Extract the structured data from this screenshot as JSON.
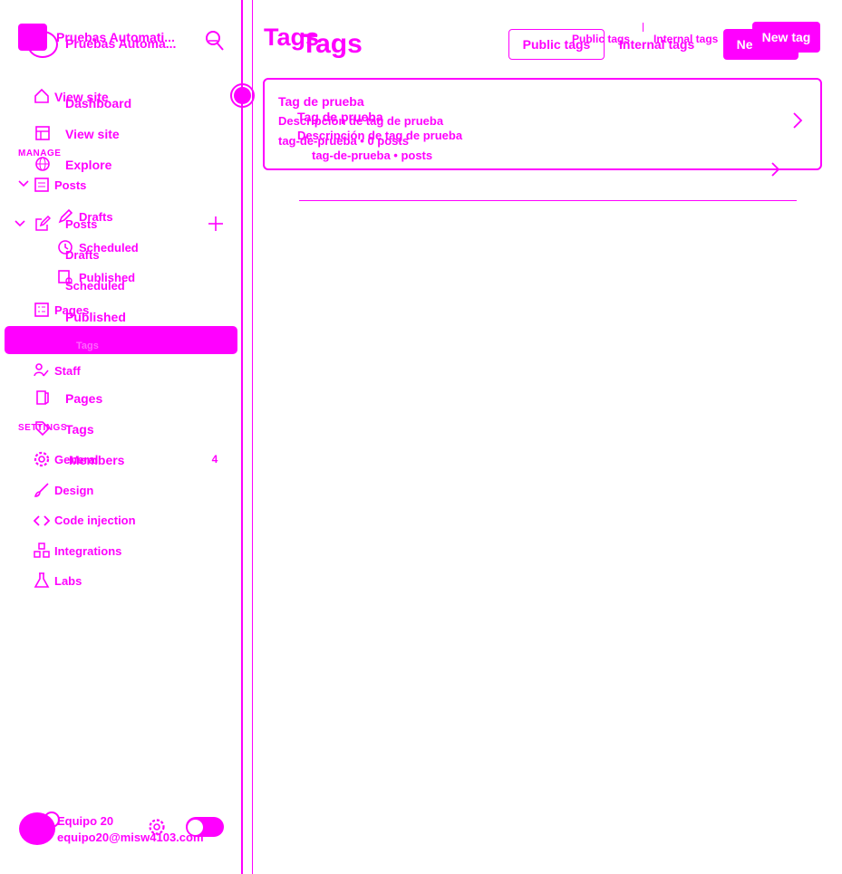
{
  "brand": {
    "site_title_a": "Pruebas Automati...",
    "site_title_b": "Pruebas Automa...",
    "accent_color": "#ff00ff"
  },
  "sidebar_a": {
    "items": [
      {
        "label": "View site",
        "icon": "home-icon"
      },
      {
        "label": "Posts",
        "icon": "posts-icon"
      },
      {
        "label": "Drafts",
        "icon": "pencil-icon"
      },
      {
        "label": "Scheduled",
        "icon": "clock-icon"
      },
      {
        "label": "Published",
        "icon": "published-icon"
      },
      {
        "label": "Pages",
        "icon": "pages-icon"
      },
      {
        "label": "Tags",
        "icon": "tag-icon"
      },
      {
        "label": "Staff",
        "icon": "staff-icon"
      },
      {
        "label": "General",
        "icon": "gear-icon"
      },
      {
        "label": "Design",
        "icon": "brush-icon"
      },
      {
        "label": "Code injection",
        "icon": "code-icon"
      },
      {
        "label": "Integrations",
        "icon": "integrations-icon"
      },
      {
        "label": "Labs",
        "icon": "flask-icon"
      }
    ],
    "sections": {
      "manage": "MANAGE",
      "settings": "SETTINGS"
    }
  },
  "sidebar_b": {
    "items": [
      {
        "label": "Dashboard",
        "icon": "dashboard-icon"
      },
      {
        "label": "View site",
        "icon": "layout-icon"
      },
      {
        "label": "Explore",
        "icon": "globe-icon"
      },
      {
        "label": "Posts",
        "icon": "edit-icon"
      },
      {
        "label": "Drafts"
      },
      {
        "label": "Scheduled"
      },
      {
        "label": "Published"
      },
      {
        "label": "Pages",
        "icon": "book-icon"
      },
      {
        "label": "Tags",
        "icon": "tag-icon"
      },
      {
        "label": "Members",
        "icon": "members-icon"
      }
    ],
    "members_count": "4"
  },
  "header": {
    "title_a": "Tags",
    "title_b": "Tags",
    "tabs_a": [
      "Public tags",
      "Internal tags"
    ],
    "tabs_b": [
      "Public tags",
      "Internal tags"
    ],
    "new_button_a": "New tag",
    "new_button_b": "New tag"
  },
  "tags_a": [
    {
      "name": "Tag de prueba",
      "description": "Descripción de tag de prueba",
      "meta": "tag-de-prueba • 0 posts"
    }
  ],
  "tags_b": [
    {
      "name": "Tag de prueba",
      "description": "Descripción de tag de prueba",
      "meta": "tag-de-prueba • posts"
    }
  ],
  "user": {
    "name": "Equipo 20",
    "email": "equipo20@misw4103.com"
  }
}
